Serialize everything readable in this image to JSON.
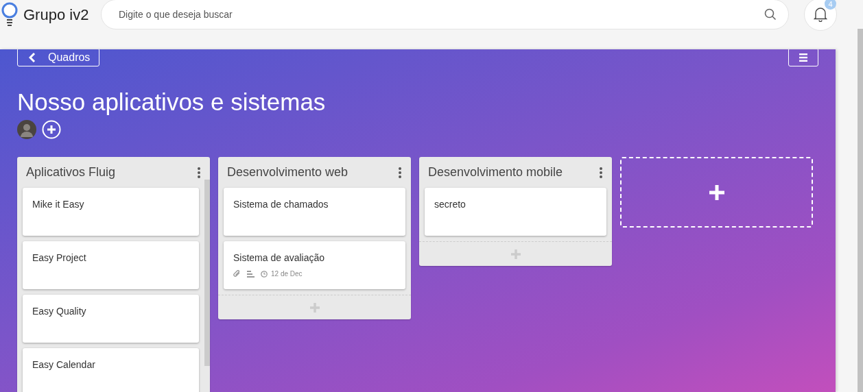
{
  "header": {
    "brand": "Grupo iv2",
    "search": {
      "placeholder": "Digite o que deseja buscar"
    },
    "notifications": {
      "count": "4"
    }
  },
  "board": {
    "back_button": "Quadros",
    "title": "Nosso aplicativos e sistemas",
    "lists": [
      {
        "title": "Aplicativos Fluig",
        "scrollable": true,
        "cards": [
          {
            "title": "Mike it Easy"
          },
          {
            "title": "Easy Project"
          },
          {
            "title": "Easy Quality"
          },
          {
            "title": "Easy Calendar"
          }
        ]
      },
      {
        "title": "Desenvolvimento web",
        "scrollable": false,
        "cards": [
          {
            "title": "Sistema de chamados"
          },
          {
            "title": "Sistema de avaliação",
            "attachment": true,
            "description": true,
            "due": "12 de Dec"
          }
        ]
      },
      {
        "title": "Desenvolvimento mobile",
        "scrollable": false,
        "cards": [
          {
            "title": "secreto"
          }
        ]
      }
    ]
  }
}
